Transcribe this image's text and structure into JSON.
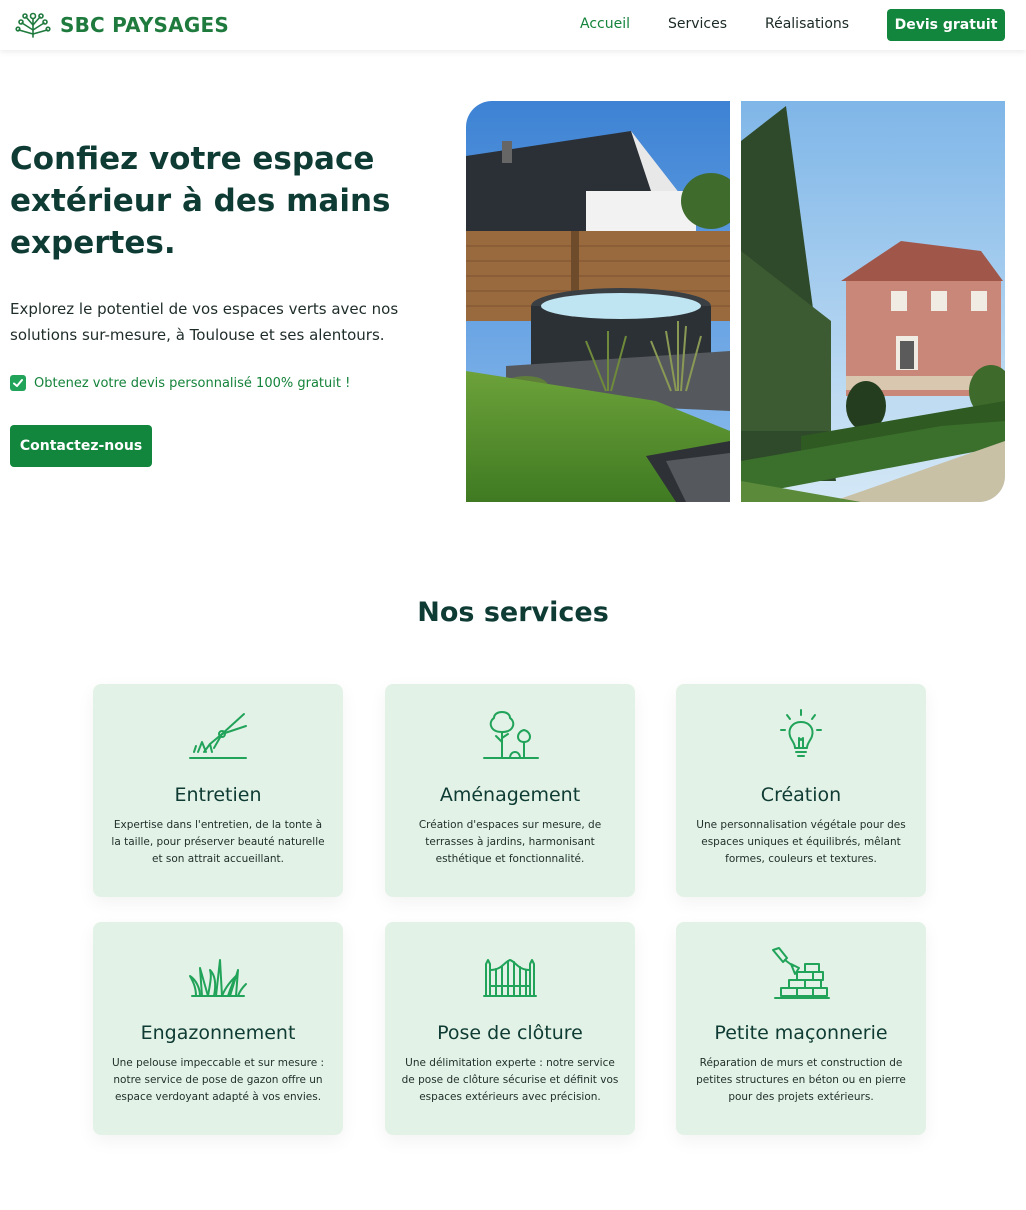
{
  "brand": {
    "name": "SBC PAYSAGES",
    "color": "#1f7a3e"
  },
  "nav": {
    "links": [
      {
        "label": "Accueil",
        "active": true
      },
      {
        "label": "Services",
        "active": false
      },
      {
        "label": "Réalisations",
        "active": false
      }
    ],
    "cta": "Devis gratuit"
  },
  "hero": {
    "title": "Confiez votre espace extérieur à des mains expertes.",
    "subtitle": "Explorez le potentiel de vos espaces verts avec nos solutions sur-mesure, à Toulouse et ses alentours.",
    "check": "Obtenez votre devis personnalisé 100% gratuit !",
    "button": "Contactez-nous"
  },
  "services": {
    "title": "Nos services",
    "items": [
      {
        "icon": "hedge-trimmer-icon",
        "title": "Entretien",
        "desc": "Expertise dans l'entretien, de la tonte à la taille, pour préserver beauté naturelle et son attrait accueillant."
      },
      {
        "icon": "trees-icon",
        "title": "Aménagement",
        "desc": "Création d'espaces sur mesure, de terrasses à jardins, harmonisant esthétique et fonctionnalité."
      },
      {
        "icon": "lightbulb-icon",
        "title": "Création",
        "desc": "Une personnalisation végétale pour des espaces uniques et équilibrés, mêlant formes, couleurs et textures."
      },
      {
        "icon": "grass-icon",
        "title": "Engazonnement",
        "desc": "Une pelouse impeccable et sur mesure : notre service de pose de gazon offre un espace verdoyant adapté à vos envies."
      },
      {
        "icon": "fence-icon",
        "title": "Pose de clôture",
        "desc": "Une délimitation experte : notre service de pose de clôture sécurise et définit vos espaces extérieurs avec précision."
      },
      {
        "icon": "trowel-bricks-icon",
        "title": "Petite maçonnerie",
        "desc": "Réparation de murs et construction de petites structures en béton ou en pierre pour des projets extérieurs."
      }
    ]
  },
  "colors": {
    "primary": "#11863c",
    "heading": "#0e3b33",
    "card_bg": "#e3f2e6"
  }
}
